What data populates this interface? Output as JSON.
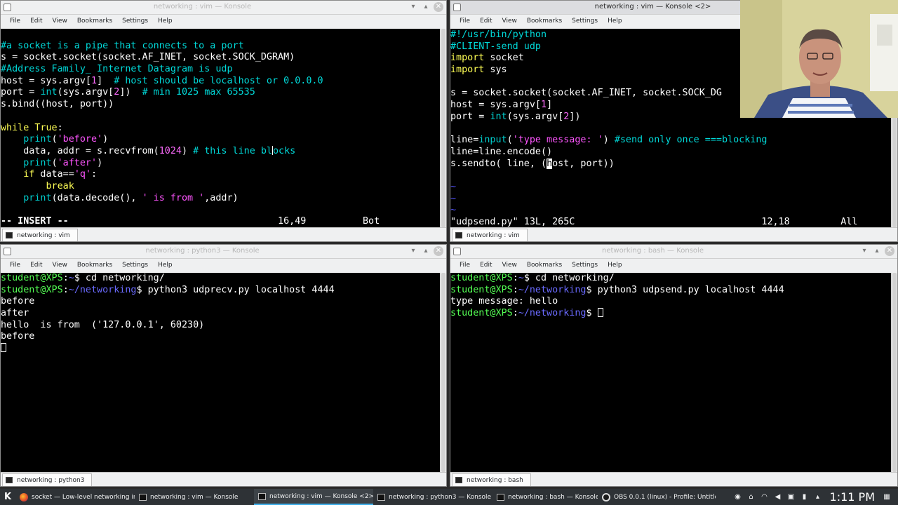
{
  "menu": [
    "File",
    "Edit",
    "View",
    "Bookmarks",
    "Settings",
    "Help"
  ],
  "windows": {
    "top_left": {
      "title": "networking : vim — Konsole",
      "tab": "networking : vim",
      "lines": [
        "",
        "#a socket is a pipe that connects to a port",
        "s = socket.socket(socket.AF_INET, socket.SOCK_DGRAM)",
        "#Address Family_ Internet Datagram is udp",
        "host = sys.argv[1]  # host should be localhost or 0.0.0.0",
        "port = int(sys.argv[2])  # min 1025 max 65535",
        "s.bind((host, port))",
        "",
        "while True:",
        "    print('before')",
        "    data, addr = s.recvfrom(1024) # this line blocks",
        "    print('after')",
        "    if data=='q':",
        "        break",
        "    print(data.decode(), ' is from ',addr)",
        "",
        "-- INSERT --                                     16,49          Bot"
      ]
    },
    "top_right": {
      "title": "networking : vim — Konsole <2>",
      "tab": "networking : vim",
      "lines": [
        "#!/usr/bin/python",
        "#CLIENT-send udp",
        "import socket",
        "import sys",
        "",
        "s = socket.socket(socket.AF_INET, socket.SOCK_DG",
        "host = sys.argv[1]",
        "port = int(sys.argv[2])",
        "",
        "line=input('type message: ') #send only once ===blocking",
        "line=line.encode()",
        "s.sendto( line, (host, port))",
        "",
        "~",
        "~",
        "~",
        "\"udpsend.py\" 13L, 265C                                 12,18         All"
      ]
    },
    "bottom_left": {
      "title": "networking : python3 — Konsole",
      "tab": "networking : python3",
      "lines": [
        "student@XPS:~$ cd networking/",
        "student@XPS:~/networking$ python3 udprecv.py localhost 4444",
        "before",
        "after",
        "hello  is from  ('127.0.0.1', 60230)",
        "before"
      ]
    },
    "bottom_right": {
      "title": "networking : bash — Konsole",
      "tab": "networking : bash",
      "lines": [
        "student@XPS:~$ cd networking/",
        "student@XPS:~/networking$ python3 udpsend.py localhost 4444",
        "type message: hello",
        "student@XPS:~/networking$ "
      ]
    }
  },
  "taskbar": {
    "tasks": [
      {
        "label": "socket — Low-level networking in...",
        "icon": "firefox-icon"
      },
      {
        "label": "networking : vim — Konsole",
        "icon": "terminal-icon"
      },
      {
        "label": "networking : vim — Konsole <2>",
        "icon": "terminal-icon"
      },
      {
        "label": "networking : python3 — Konsole",
        "icon": "terminal-icon"
      },
      {
        "label": "networking : bash — Konsole",
        "icon": "terminal-icon"
      },
      {
        "label": "OBS 0.0.1 (linux) - Profile: Untitle...",
        "icon": "obs-icon"
      }
    ],
    "clock": "1:11 PM"
  },
  "colors": {
    "comment": "#00dada",
    "string": "#ff55ff",
    "keyword": "#ffff55",
    "prompt_user": "#54ff54",
    "prompt_path": "#6a6aff",
    "taskbar_bg": "#2e3236",
    "active_accent": "#3daee9"
  }
}
